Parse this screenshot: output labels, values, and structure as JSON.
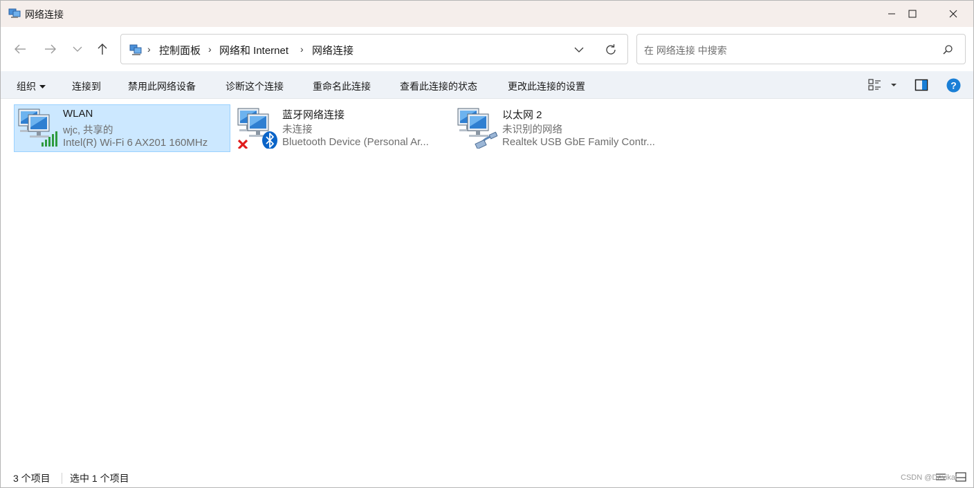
{
  "window": {
    "title": "网络连接"
  },
  "nav": {
    "breadcrumbs": [
      "控制面板",
      "网络和 Internet",
      "网络连接"
    ],
    "search_placeholder": "在 网络连接 中搜索"
  },
  "toolbar": {
    "organize": "组织",
    "connect_to": "连接到",
    "disable_device": "禁用此网络设备",
    "diagnose": "诊断这个连接",
    "rename": "重命名此连接",
    "view_status": "查看此连接的状态",
    "change_settings": "更改此连接的设置"
  },
  "connections": [
    {
      "name": "WLAN",
      "status": "wjc, 共享的",
      "device": "Intel(R) Wi-Fi 6 AX201 160MHz",
      "selected": true,
      "icon": "wifi-computer-icon"
    },
    {
      "name": "蓝牙网络连接",
      "status": "未连接",
      "device": "Bluetooth Device (Personal Ar...",
      "selected": false,
      "icon": "bluetooth-computer-icon"
    },
    {
      "name": "以太网 2",
      "status": "未识别的网络",
      "device": "Realtek USB GbE Family Contr...",
      "selected": false,
      "icon": "ethernet-computer-icon"
    }
  ],
  "statusbar": {
    "item_count": "3 个项目",
    "selected_count": "选中 1 个项目",
    "watermark": "CSDN @Devikai"
  },
  "colors": {
    "titlebar_bg": "#f5eeeb",
    "cmdbar_bg": "#eef2f7",
    "selection_bg": "#cce8ff",
    "selection_border": "#99d1ff",
    "help_blue": "#1a7fd6",
    "wifi_green": "#2e9b3e",
    "error_red": "#e01b1b",
    "bluetooth_blue": "#0a64c8"
  }
}
